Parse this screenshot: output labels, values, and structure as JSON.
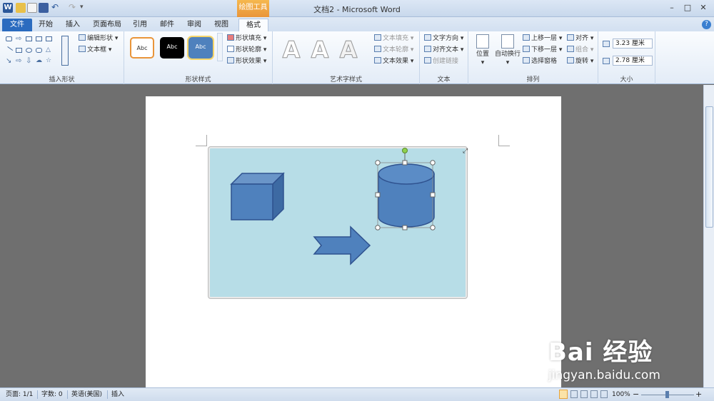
{
  "window": {
    "logo_letter": "W",
    "title": "文档2  -  Microsoft Word",
    "context_tab": "绘图工具",
    "minimize": "–",
    "restore": "□",
    "close": "✕",
    "help": "?"
  },
  "tabs": [
    "文件",
    "开始",
    "插入",
    "页面布局",
    "引用",
    "邮件",
    "审阅",
    "视图",
    "格式"
  ],
  "ribbon": {
    "insert_shapes": {
      "label": "插入形状",
      "edit_shape": "编辑形状",
      "text_box": "文本框"
    },
    "shape_styles": {
      "label": "形状样式",
      "presets": [
        "Abc",
        "Abc",
        "Abc"
      ],
      "fill": "形状填充",
      "outline": "形状轮廓",
      "effects": "形状效果"
    },
    "wordart": {
      "label": "艺术字样式",
      "samples": [
        "A",
        "A",
        "A"
      ],
      "text_fill": "文本填充",
      "text_outline": "文本轮廓",
      "text_effects": "文本效果"
    },
    "text": {
      "label": "文本",
      "direction": "文字方向",
      "align": "对齐文本",
      "link": "创建链接"
    },
    "arrange": {
      "label": "排列",
      "position": "位置",
      "wrap": "自动换行",
      "bring_forward": "上移一层",
      "send_backward": "下移一层",
      "selection_pane": "选择窗格",
      "align": "对齐",
      "group": "组合",
      "rotate": "旋转"
    },
    "size": {
      "label": "大小",
      "height": "3.23 厘米",
      "width": "2.78 厘米"
    }
  },
  "status": {
    "page": "页面: 1/1",
    "words": "字数: 0",
    "language": "英语(美国)",
    "mode": "插入",
    "zoom": "100%",
    "zoom_minus": "−",
    "zoom_plus": "+"
  },
  "watermark": {
    "brand": "Bai 经验",
    "url": "jingyan.baidu.com"
  },
  "colors": {
    "canvas_fill": "#b7dde7",
    "shape_fill": "#4f81bd",
    "shape_outline": "#2f528f",
    "rotate_handle": "#8fd14f"
  }
}
